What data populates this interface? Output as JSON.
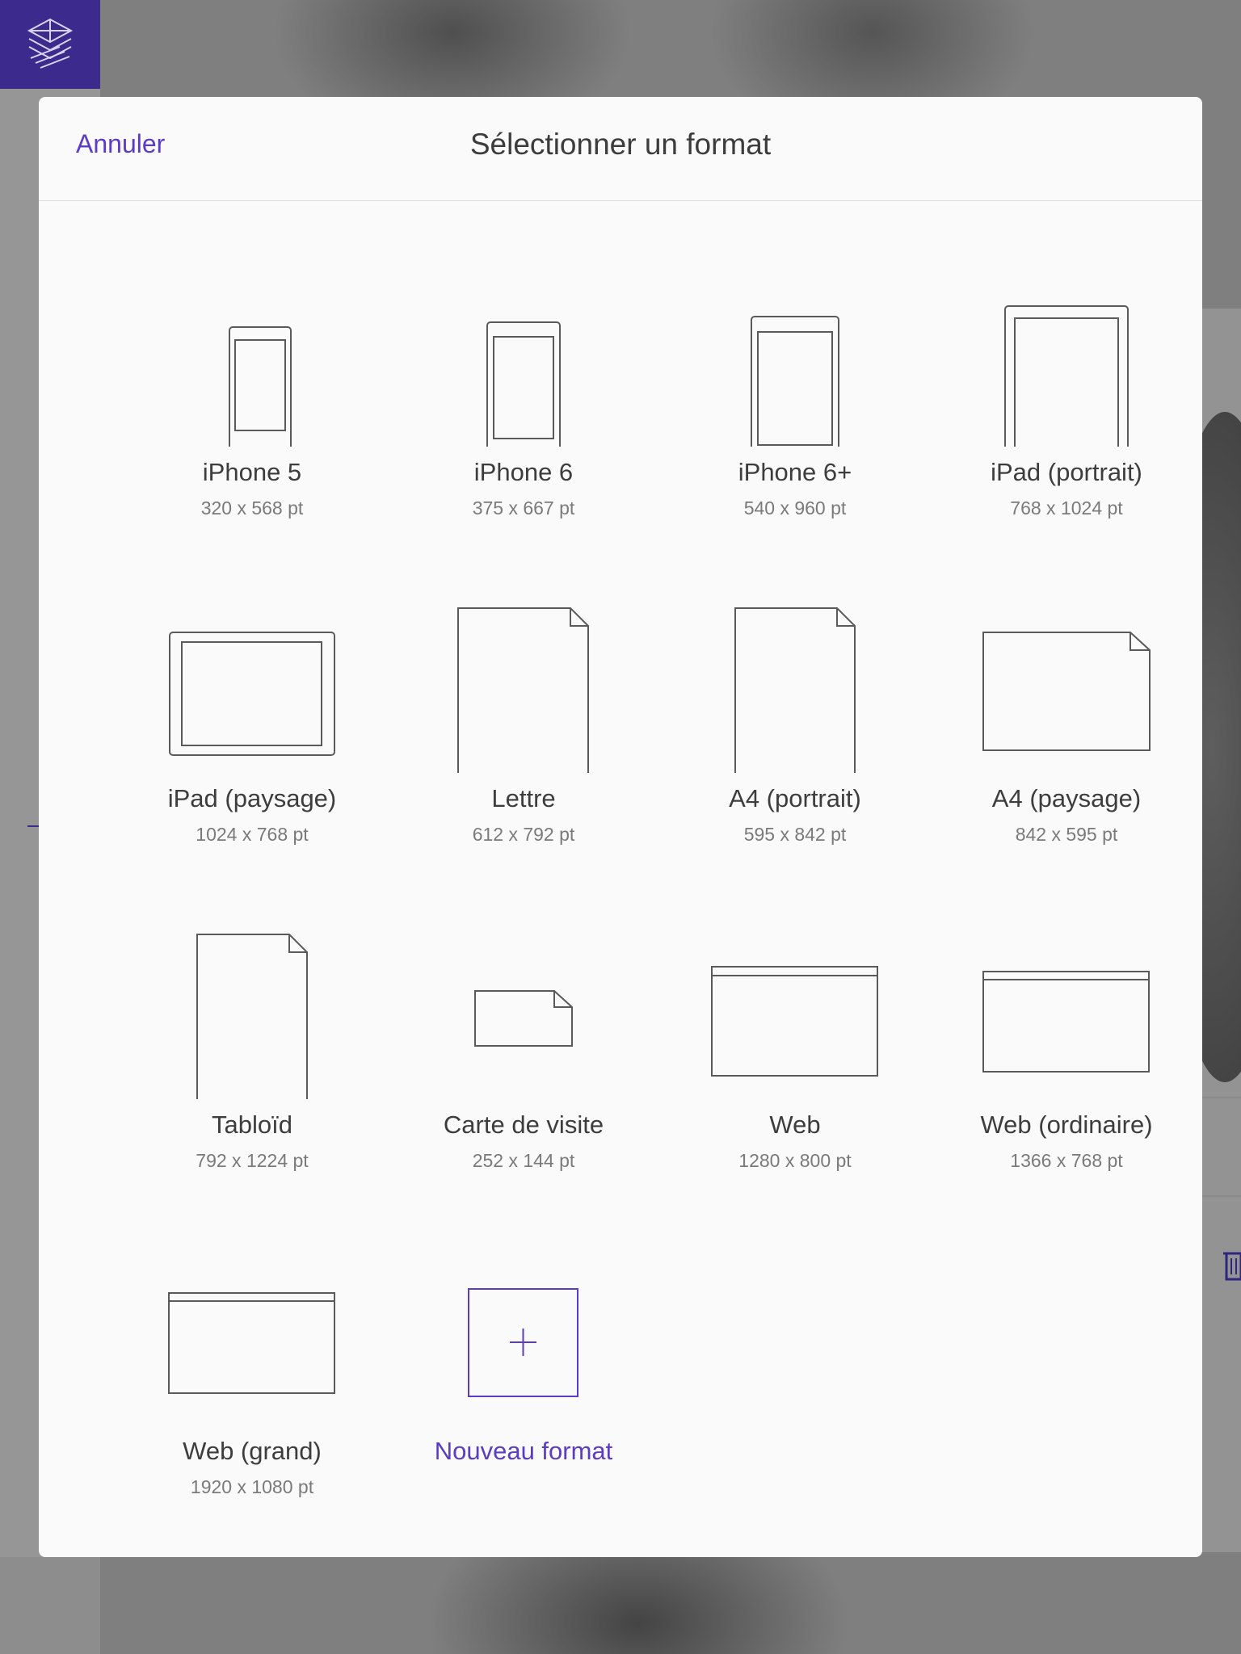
{
  "header": {
    "cancel_label": "Annuler",
    "title": "Sélectionner un format"
  },
  "formats": [
    {
      "name": "iPhone 5",
      "size": "320 x 568 pt",
      "icon": "phone-icon"
    },
    {
      "name": "iPhone 6",
      "size": "375 x 667 pt",
      "icon": "phone-icon"
    },
    {
      "name": "iPhone 6+",
      "size": "540 x 960 pt",
      "icon": "phone-icon"
    },
    {
      "name": "iPad (portrait)",
      "size": "768 x 1024 pt",
      "icon": "tablet-portrait-icon"
    },
    {
      "name": "iPad (paysage)",
      "size": "1024 x 768 pt",
      "icon": "tablet-landscape-icon"
    },
    {
      "name": "Lettre",
      "size": "612 x 792 pt",
      "icon": "page-portrait-icon"
    },
    {
      "name": "A4 (portrait)",
      "size": "595 x 842 pt",
      "icon": "page-portrait-icon"
    },
    {
      "name": "A4 (paysage)",
      "size": "842 x 595 pt",
      "icon": "page-landscape-icon"
    },
    {
      "name": "Tabloïd",
      "size": "792 x 1224 pt",
      "icon": "page-portrait-icon"
    },
    {
      "name": "Carte de visite",
      "size": "252 x 144 pt",
      "icon": "business-card-icon"
    },
    {
      "name": "Web",
      "size": "1280 x 800 pt",
      "icon": "browser-window-icon"
    },
    {
      "name": "Web (ordinaire)",
      "size": "1366 x 768 pt",
      "icon": "browser-window-icon"
    },
    {
      "name": "Web (grand)",
      "size": "1920 x 1080 pt",
      "icon": "browser-window-icon"
    }
  ],
  "new_format": {
    "label": "Nouveau format",
    "icon": "plus-icon"
  },
  "colors": {
    "accent": "#5b3cc4",
    "brand": "#3c2a8c"
  }
}
